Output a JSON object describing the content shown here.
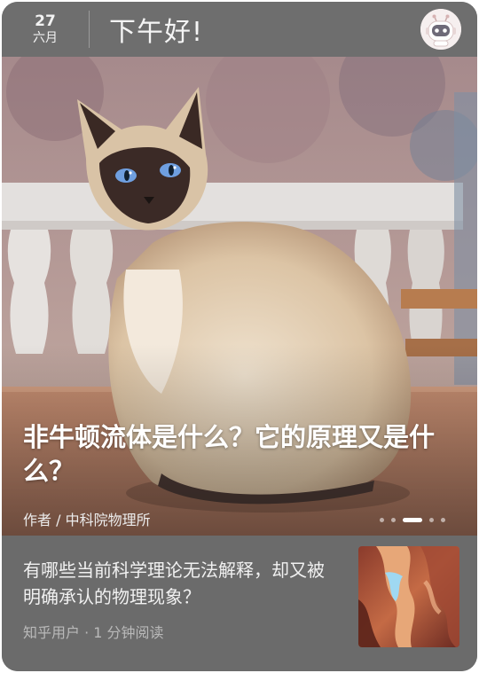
{
  "header": {
    "date_day": "27",
    "date_month": "六月",
    "greeting": "下午好!"
  },
  "hero": {
    "title": "非牛顿流体是什么？它的原理又是什么？",
    "author": "作者 / 中科院物理所",
    "carousel": {
      "count": 5,
      "active_index": 2
    }
  },
  "article": {
    "title": "有哪些当前科学理论无法解释，却又被明确承认的物理现象？",
    "meta": "知乎用户 · 1 分钟阅读"
  },
  "icons": {
    "avatar": "robot-avatar-icon"
  }
}
